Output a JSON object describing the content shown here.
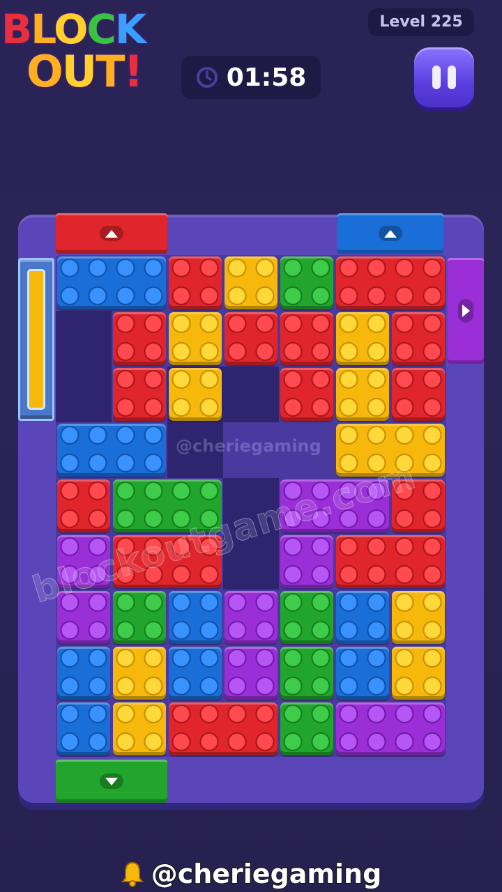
{
  "header": {
    "logo_line1": [
      "B",
      "L",
      "O",
      "C",
      "K"
    ],
    "logo_line2": [
      "O",
      "U",
      "T",
      "!"
    ],
    "level_label": "Level 225",
    "timer": "01:58"
  },
  "watermarks": {
    "small": "@cheriegaming",
    "large": "blockoutgame.com"
  },
  "footer": {
    "handle": "@cheriegaming"
  },
  "colors": {
    "red": "#e0252c",
    "yellow": "#f5b80b",
    "green": "#22a52d",
    "blue": "#1a6ed8",
    "purple": "#9a2fd8",
    "board": "#5a46b8",
    "background": "#2a2355"
  },
  "gates": [
    {
      "name": "red-exit-gate-top",
      "color": "red",
      "side": "top",
      "arrow": "up"
    },
    {
      "name": "blue-exit-gate-top",
      "color": "blue",
      "side": "top",
      "arrow": "up"
    },
    {
      "name": "purple-exit-gate-right",
      "color": "purple",
      "side": "right",
      "arrow": "right"
    },
    {
      "name": "green-exit-gate-bottom",
      "color": "green",
      "side": "bottom",
      "arrow": "down"
    },
    {
      "name": "yellow-exit-gate-left",
      "color": "yellow",
      "side": "left",
      "arrow": "none"
    }
  ],
  "grid": {
    "columns": 7,
    "rows": 9
  },
  "blocks": [
    {
      "color": "blue",
      "cells": [
        [
          0,
          0
        ],
        [
          1,
          0
        ]
      ]
    },
    {
      "color": "red",
      "cells": [
        [
          2,
          0
        ]
      ]
    },
    {
      "color": "yellow",
      "cells": [
        [
          3,
          0
        ]
      ]
    },
    {
      "color": "green",
      "cells": [
        [
          4,
          0
        ]
      ]
    },
    {
      "color": "red",
      "cells": [
        [
          5,
          0
        ],
        [
          6,
          0
        ],
        [
          6,
          1
        ],
        [
          6,
          2
        ]
      ]
    },
    {
      "color": "red",
      "cells": [
        [
          1,
          1
        ],
        [
          1,
          2
        ]
      ]
    },
    {
      "color": "yellow",
      "cells": [
        [
          2,
          1
        ],
        [
          2,
          2
        ]
      ]
    },
    {
      "color": "red",
      "cells": [
        [
          3,
          1
        ]
      ]
    },
    {
      "color": "red",
      "cells": [
        [
          4,
          1
        ],
        [
          4,
          2
        ]
      ]
    },
    {
      "color": "yellow",
      "cells": [
        [
          5,
          1
        ],
        [
          5,
          2
        ],
        [
          5,
          3
        ],
        [
          6,
          3
        ]
      ]
    },
    {
      "color": "blue",
      "cells": [
        [
          0,
          3
        ],
        [
          1,
          3
        ]
      ]
    },
    {
      "color": "red",
      "cells": [
        [
          0,
          4
        ]
      ]
    },
    {
      "color": "green",
      "cells": [
        [
          1,
          4
        ],
        [
          2,
          4
        ]
      ]
    },
    {
      "color": "purple",
      "cells": [
        [
          4,
          4
        ],
        [
          5,
          4
        ],
        [
          4,
          5
        ]
      ]
    },
    {
      "color": "red",
      "cells": [
        [
          6,
          4
        ],
        [
          5,
          5
        ],
        [
          6,
          5
        ]
      ]
    },
    {
      "color": "purple",
      "cells": [
        [
          0,
          5
        ],
        [
          0,
          6
        ]
      ]
    },
    {
      "color": "red",
      "cells": [
        [
          1,
          5
        ],
        [
          2,
          5
        ]
      ]
    },
    {
      "color": "green",
      "cells": [
        [
          1,
          6
        ]
      ]
    },
    {
      "color": "blue",
      "cells": [
        [
          2,
          6
        ],
        [
          2,
          7
        ]
      ]
    },
    {
      "color": "purple",
      "cells": [
        [
          3,
          6
        ],
        [
          3,
          7
        ]
      ]
    },
    {
      "color": "green",
      "cells": [
        [
          4,
          6
        ],
        [
          4,
          7
        ],
        [
          4,
          8
        ]
      ]
    },
    {
      "color": "blue",
      "cells": [
        [
          5,
          6
        ],
        [
          5,
          7
        ]
      ]
    },
    {
      "color": "yellow",
      "cells": [
        [
          6,
          6
        ],
        [
          6,
          7
        ]
      ]
    },
    {
      "color": "blue",
      "cells": [
        [
          0,
          7
        ],
        [
          0,
          8
        ]
      ]
    },
    {
      "color": "yellow",
      "cells": [
        [
          1,
          7
        ],
        [
          1,
          8
        ]
      ]
    },
    {
      "color": "red",
      "cells": [
        [
          2,
          8
        ],
        [
          3,
          8
        ]
      ]
    },
    {
      "color": "purple",
      "cells": [
        [
          5,
          8
        ],
        [
          6,
          8
        ]
      ]
    }
  ]
}
